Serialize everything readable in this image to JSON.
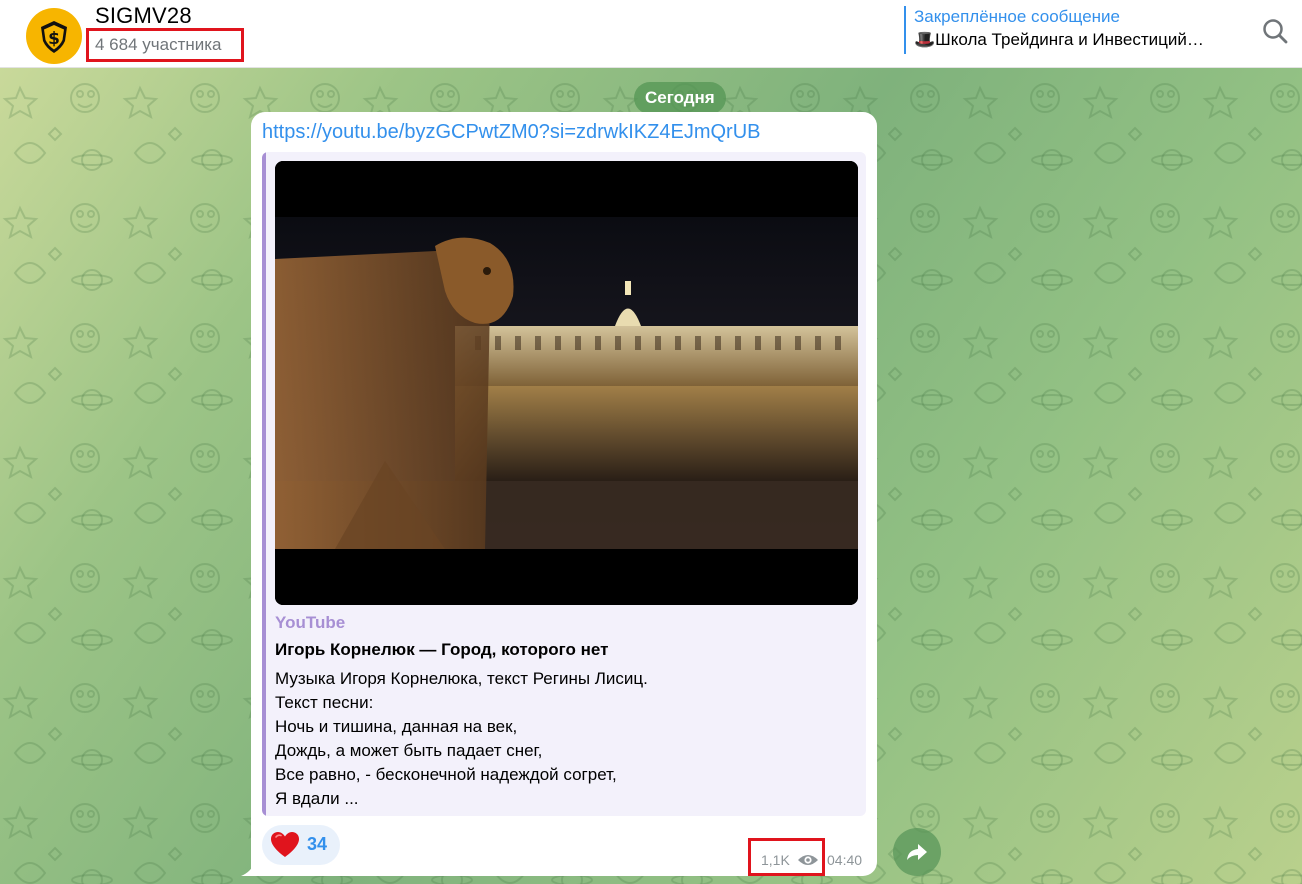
{
  "header": {
    "channel_title": "SIGMV28",
    "members": "4 684 участника",
    "pinned": {
      "title": "Закреплённое сообщение",
      "text": "🎩Школа Трейдинга и Инвестиций…"
    },
    "search_icon": "search-icon",
    "avatar_icon": "dollar-shield-icon",
    "colors": {
      "accent": "#3390ec",
      "avatar": "#f7b500",
      "highlight": "#e0141d"
    }
  },
  "chat": {
    "date_label": "Сегодня",
    "message": {
      "link": "https://youtu.be/byzGCPwtZM0?si=zdrwkIKZ4EJmQrUB",
      "preview": {
        "site": "YouTube",
        "title": "Игорь Корнелюк — Город, которого нет",
        "description": [
          "Музыка Игоря Корнелюка, текст Регины Лисиц.",
          "Текст песни:",
          "Ночь и тишина, данная на век,",
          "Дождь, а может быть падает снег,",
          "Все равно, - бесконечной надеждой согрет,",
          "Я вдали ..."
        ]
      },
      "reaction": {
        "emoji": "heart-icon",
        "count": "34"
      },
      "views": "1,1K",
      "time": "04:40"
    },
    "forward_icon": "forward-icon"
  }
}
